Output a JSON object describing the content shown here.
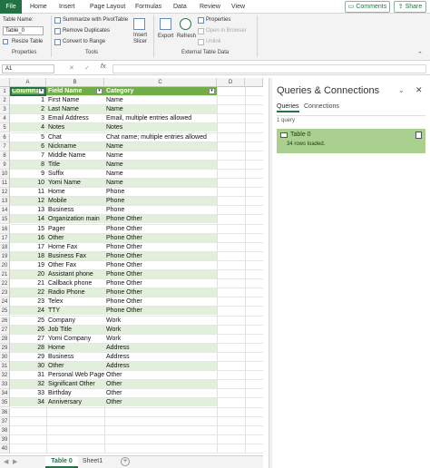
{
  "menu": {
    "file": "File",
    "tabs": [
      "Home",
      "Insert",
      "Page Layout",
      "Formulas",
      "Data",
      "Review",
      "View"
    ],
    "comments": "Comments",
    "share": "Share"
  },
  "ribbon": {
    "properties": {
      "table_name_label": "Table Name:",
      "table_name_value": "Table_0",
      "resize": "Resize Table",
      "group": "Properties"
    },
    "tools": {
      "summarize": "Summarize with PivotTable",
      "remove_dup": "Remove Duplicates",
      "convert": "Convert to Range",
      "insert_slicer": [
        "Insert",
        "Slicer"
      ],
      "group": "Tools"
    },
    "external": {
      "export": "Export",
      "refresh": "Refresh",
      "properties": "Properties",
      "open_browser": "Open in Browser",
      "unlink": "Unlink",
      "group": "External Table Data"
    }
  },
  "formula_bar": {
    "name_box": "A1",
    "fx": "fx",
    "cancel": "✕",
    "enter": "✓"
  },
  "grid": {
    "columns": [
      "A",
      "B",
      "C",
      "D"
    ],
    "headers": [
      "Column1",
      "Field Name",
      "Category"
    ],
    "rows": [
      [
        "1",
        "First Name",
        "Name"
      ],
      [
        "2",
        "Last Name",
        "Name"
      ],
      [
        "3",
        "Email Address",
        "Email, multiple entries allowed"
      ],
      [
        "4",
        "Notes",
        "Notes"
      ],
      [
        "5",
        "Chat",
        "Chat name; multiple entries allowed"
      ],
      [
        "6",
        "Nickname",
        "Name"
      ],
      [
        "7",
        "Middle Name",
        "Name"
      ],
      [
        "8",
        "Title",
        "Name"
      ],
      [
        "9",
        "Suffix",
        "Name"
      ],
      [
        "10",
        "Yomi Name",
        "Name"
      ],
      [
        "11",
        "Home",
        "Phone"
      ],
      [
        "12",
        "Mobile",
        "Phone"
      ],
      [
        "13",
        "Business",
        "Phone"
      ],
      [
        "14",
        "Organization main",
        "Phone Other"
      ],
      [
        "15",
        "Pager",
        "Phone Other"
      ],
      [
        "16",
        "Other",
        "Phone Other"
      ],
      [
        "17",
        "Home Fax",
        "Phone Other"
      ],
      [
        "18",
        "Business Fax",
        "Phone Other"
      ],
      [
        "19",
        "Other Fax",
        "Phone Other"
      ],
      [
        "20",
        "Assistant phone",
        "Phone Other"
      ],
      [
        "21",
        "Callback phone",
        "Phone Other"
      ],
      [
        "22",
        "Radio Phone",
        "Phone Other"
      ],
      [
        "23",
        "Telex",
        "Phone Other"
      ],
      [
        "24",
        "TTY",
        "Phone Other"
      ],
      [
        "25",
        "Company",
        "Work"
      ],
      [
        "26",
        "Job Title",
        "Work"
      ],
      [
        "27",
        "Yomi Company",
        "Work"
      ],
      [
        "28",
        "Home",
        "Address"
      ],
      [
        "29",
        "Business",
        "Address"
      ],
      [
        "30",
        "Other",
        "Address"
      ],
      [
        "31",
        "Personal Web Page",
        "Other"
      ],
      [
        "32",
        "Significant Other",
        "Other"
      ],
      [
        "33",
        "Birthday",
        "Other"
      ],
      [
        "34",
        "Anniversary",
        "Other"
      ]
    ],
    "row_numbers": [
      "1",
      "2",
      "3",
      "4",
      "5",
      "6",
      "7",
      "8",
      "9",
      "10",
      "11",
      "12",
      "13",
      "14",
      "15",
      "16",
      "17",
      "18",
      "19",
      "20",
      "21",
      "22",
      "23",
      "24",
      "25",
      "26",
      "27",
      "28",
      "29",
      "30",
      "31",
      "32",
      "33",
      "34",
      "35",
      "36",
      "37",
      "38",
      "39",
      "40"
    ]
  },
  "sheets": [
    "Table 0",
    "Sheet1"
  ],
  "panel": {
    "title": "Queries & Connections",
    "tab_queries": "Queries",
    "tab_connections": "Connections",
    "count": "1 query",
    "query_name": "Table 0",
    "query_status": "34 rows loaded.",
    "close": "✕",
    "collapse": "⌄"
  },
  "colors": {
    "accent": "#217346",
    "band": "#e2efda",
    "header_fill": "#70ad47",
    "query_card": "#a9d08e"
  }
}
